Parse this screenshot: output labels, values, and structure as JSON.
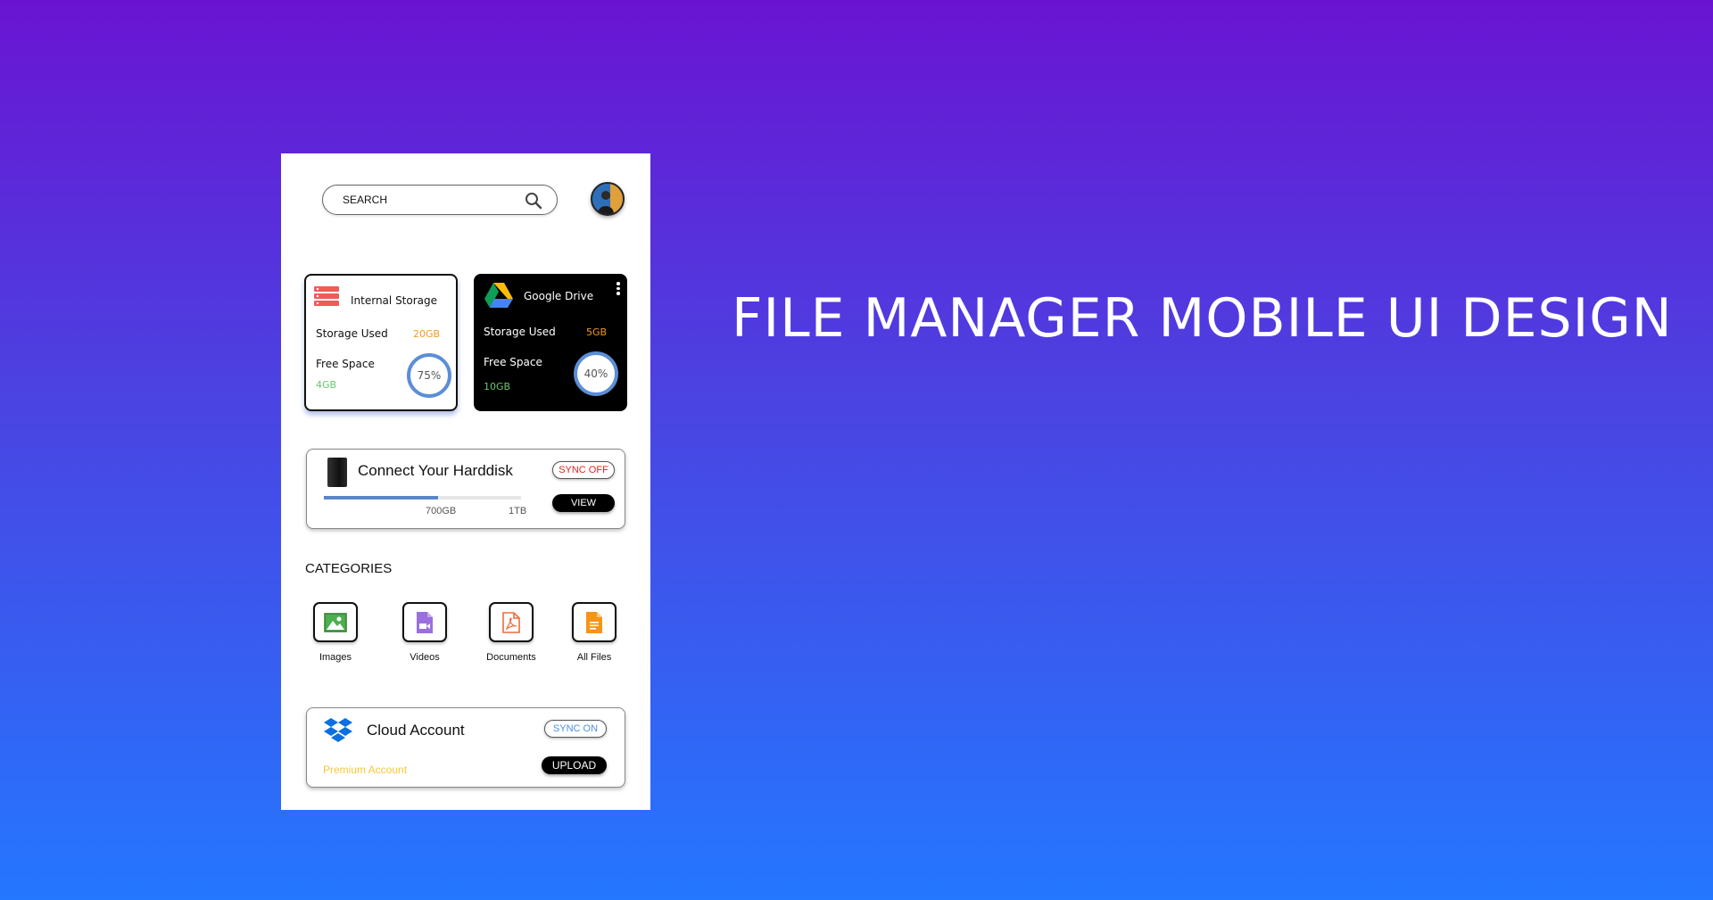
{
  "hero": {
    "title": "FILE MANAGER MOBILE UI DESIGN"
  },
  "search": {
    "placeholder": "SEARCH"
  },
  "icons": {
    "search": "search-icon",
    "avatar": "avatar",
    "internal_storage": "server-stack-icon",
    "google_drive": "google-drive-icon",
    "menu": "kebab-menu-icon",
    "harddisk": "harddisk-icon",
    "images": "image-icon",
    "videos": "video-file-icon",
    "documents": "pdf-file-icon",
    "all_files": "file-icon",
    "dropbox": "dropbox-icon"
  },
  "colors": {
    "accent_orange": "#f39a1f",
    "free_green": "#6ac66e",
    "ring_blue": "#5b8ed6",
    "sync_off_red": "#e0261d",
    "sync_on_blue": "#4a90d9",
    "premium_yellow": "#f6c73b"
  },
  "storage_cards": [
    {
      "title": "Internal Storage",
      "used_label": "Storage Used",
      "used_value": "20GB",
      "free_label": "Free Space",
      "free_value": "4GB",
      "percent": "75%"
    },
    {
      "title": "Google Drive",
      "used_label": "Storage Used",
      "used_value": "5GB",
      "free_label": "Free Space",
      "free_value": "10GB",
      "percent": "40%"
    }
  ],
  "harddisk": {
    "title": "Connect Your Harddisk",
    "sync_label": "SYNC OFF",
    "view_label": "VIEW",
    "used_label": "700GB",
    "total_label": "1TB",
    "progress": 0.58
  },
  "categories": {
    "title": "CATEGORIES",
    "items": [
      {
        "label": "Images"
      },
      {
        "label": "Videos"
      },
      {
        "label": "Documents"
      },
      {
        "label": "All Files"
      }
    ]
  },
  "cloud": {
    "title": "Cloud Account",
    "subtitle": "Premium Account",
    "sync_label": "SYNC ON",
    "upload_label": "UPLOAD"
  }
}
